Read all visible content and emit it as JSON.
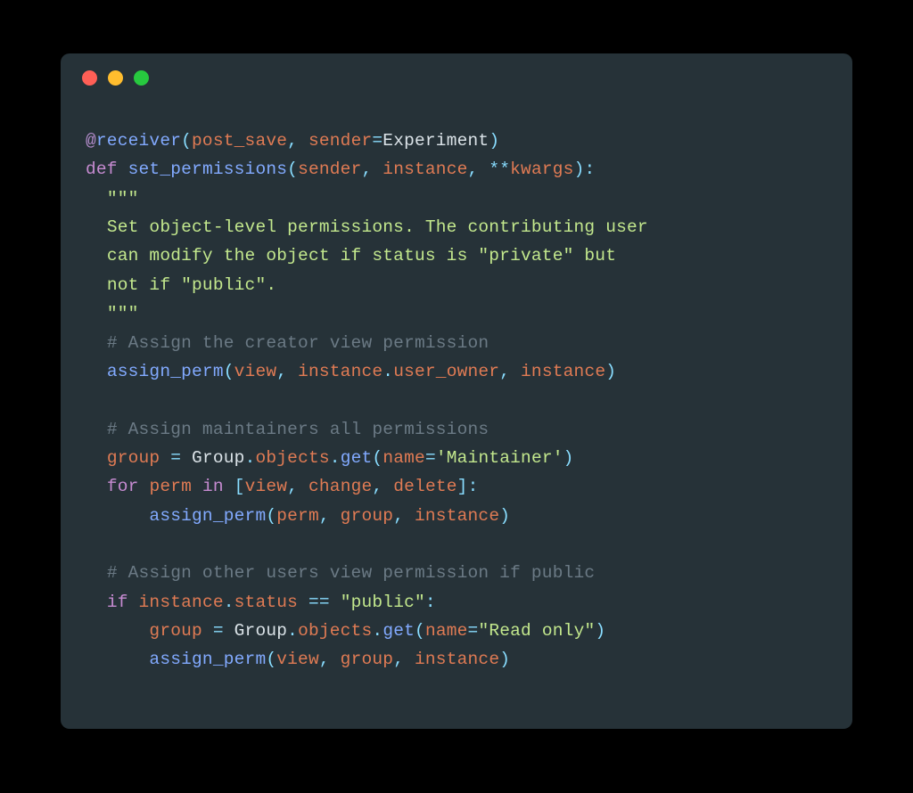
{
  "window": {
    "traffic_lights": [
      "close",
      "minimize",
      "zoom"
    ]
  },
  "colors": {
    "background_page": "#000000",
    "background_window": "#263238",
    "traffic_red": "#FF5F56",
    "traffic_yellow": "#FFBD2E",
    "traffic_green": "#27C93F",
    "keyword": "#C68BD1",
    "function": "#82aaff",
    "param": "#e07b54",
    "operator": "#89DDFF",
    "string": "#C3E88D",
    "comment": "#6b7a85",
    "default_text": "#dbe3e8"
  },
  "code": {
    "language": "python",
    "plain_text": "@receiver(post_save, sender=Experiment)\ndef set_permissions(sender, instance, **kwargs):\n  \"\"\"\n  Set object-level permissions. The contributing user\n  can modify the object if status is \"private\" but\n  not if \"public\".\n  \"\"\"\n  # Assign the creator view permission\n  assign_perm(view, instance.user_owner, instance)\n\n  # Assign maintainers all permissions\n  group = Group.objects.get(name='Maintainer')\n  for perm in [view, change, delete]:\n      assign_perm(perm, group, instance)\n\n  # Assign other users view permission if public\n  if instance.status == \"public\":\n      group = Group.objects.get(name=\"Read only\")\n      assign_perm(view, group, instance)",
    "t": {
      "at": "@",
      "receiver": "receiver",
      "lparen": "(",
      "rparen": ")",
      "post_save": "post_save",
      "comma_sp": ", ",
      "sender_kw": "sender",
      "eq": "=",
      "Experiment": "Experiment",
      "def": "def",
      "sp": " ",
      "set_permissions": "set_permissions",
      "sender": "sender",
      "instance": "instance",
      "starstar": "**",
      "kwargs": "kwargs",
      "colon": ":",
      "ind1": "  ",
      "ind2": "      ",
      "triple": "\"\"\"",
      "doc1": "Set object-level permissions. The contributing user",
      "doc2": "can modify the object if status is \"private\" but",
      "doc3": "not if \"public\".",
      "cmt1": "# Assign the creator view permission",
      "assign_perm": "assign_perm",
      "view": "view",
      "dot": ".",
      "user_owner": "user_owner",
      "blank": "",
      "cmt2": "# Assign maintainers all permissions",
      "group": "group",
      "sp_eq_sp": " = ",
      "Group": "Group",
      "objects": "objects",
      "get": "get",
      "name": "name",
      "str_maintainer": "'Maintainer'",
      "for": "for",
      "perm": "perm",
      "in": "in",
      "lbr": "[",
      "rbr": "]",
      "change": "change",
      "delete": "delete",
      "cmt3": "# Assign other users view permission if public",
      "if": "if",
      "status": "status",
      "sp_eqeq_sp": " == ",
      "str_public": "\"public\"",
      "str_readonly": "\"Read only\""
    }
  }
}
